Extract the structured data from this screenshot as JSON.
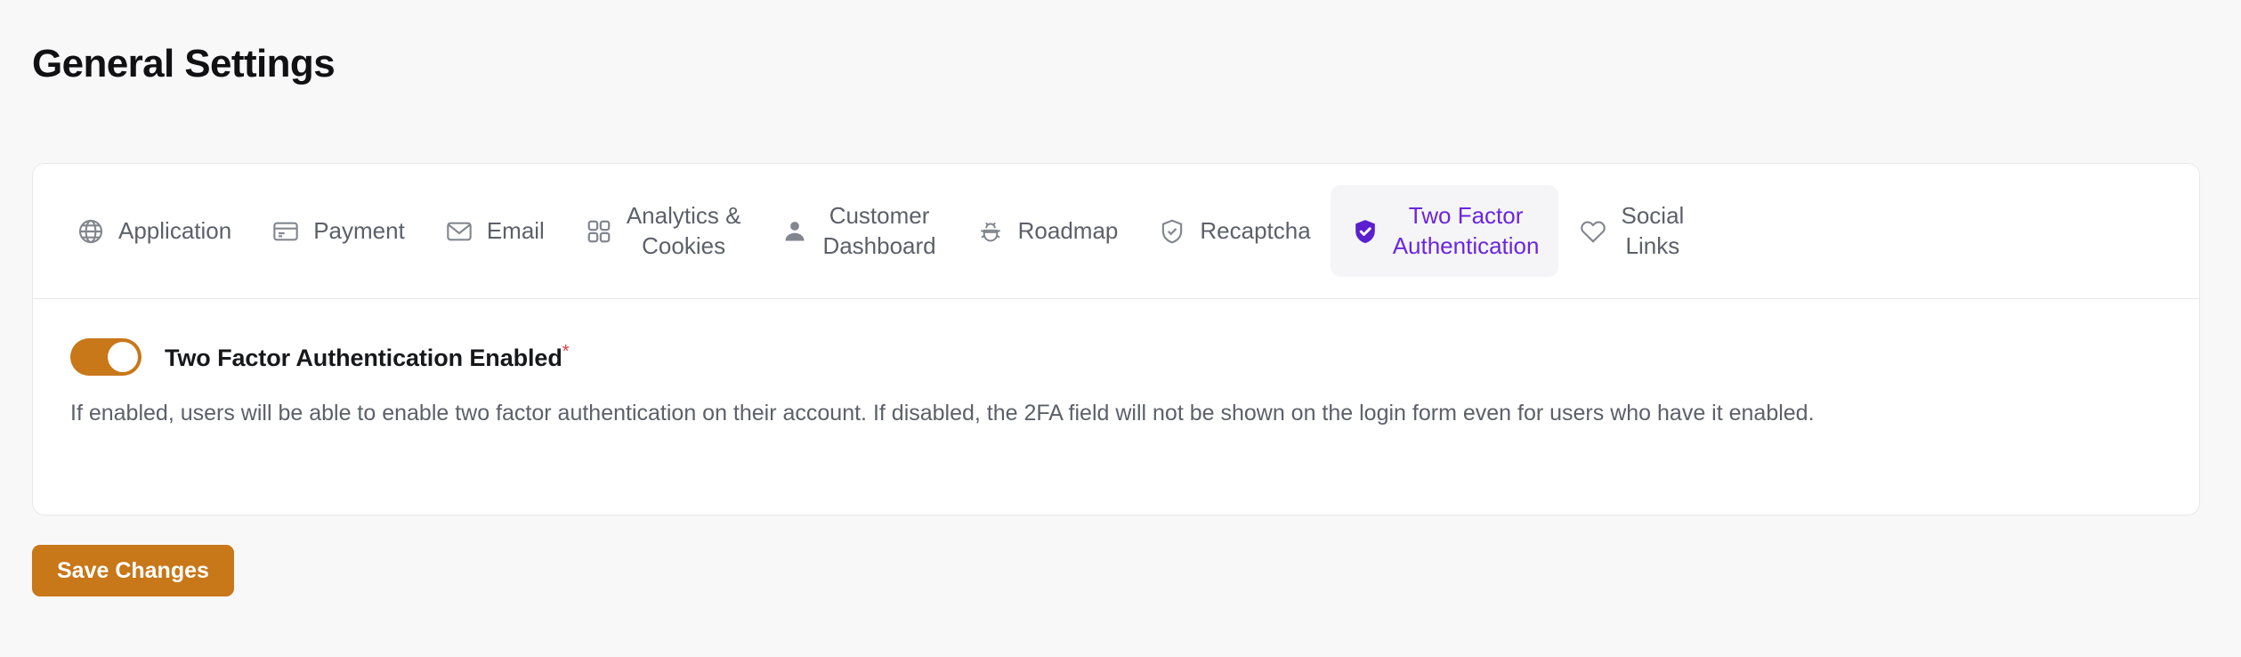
{
  "page": {
    "title": "General Settings",
    "background_color": "#F8F8F9"
  },
  "theme": {
    "accent_purple": "#6A26DE",
    "accent_orange": "#C87719",
    "muted_text": "#5C6069",
    "required_star_color": "#E23B3B"
  },
  "tabs": [
    {
      "label": "Application",
      "icon": "globe-icon",
      "active": false,
      "two_line": false
    },
    {
      "label": "Payment",
      "icon": "credit-card-icon",
      "active": false,
      "two_line": false
    },
    {
      "label": "Email",
      "icon": "envelope-icon",
      "active": false,
      "two_line": false
    },
    {
      "label": "Analytics &\nCookies",
      "icon": "grid-squares-icon",
      "active": false,
      "two_line": true
    },
    {
      "label": "Customer\nDashboard",
      "icon": "user-icon",
      "active": false,
      "two_line": true
    },
    {
      "label": "Roadmap",
      "icon": "bug-icon",
      "active": false,
      "two_line": false
    },
    {
      "label": "Recaptcha",
      "icon": "shield-check-outline-icon",
      "active": false,
      "two_line": false
    },
    {
      "label": "Two Factor\nAuthentication",
      "icon": "shield-check-filled-icon",
      "active": true,
      "two_line": true
    },
    {
      "label": "Social\nLinks",
      "icon": "heart-icon",
      "active": false,
      "two_line": true
    }
  ],
  "panel": {
    "toggle": {
      "label": "Two Factor Authentication Enabled",
      "required_marker": "*",
      "state": "on"
    },
    "help_text": "If enabled, users will be able to enable two factor authentication on their account. If disabled, the 2FA field will not be shown on the login form even for users who have it enabled."
  },
  "actions": {
    "save_label": "Save Changes"
  }
}
